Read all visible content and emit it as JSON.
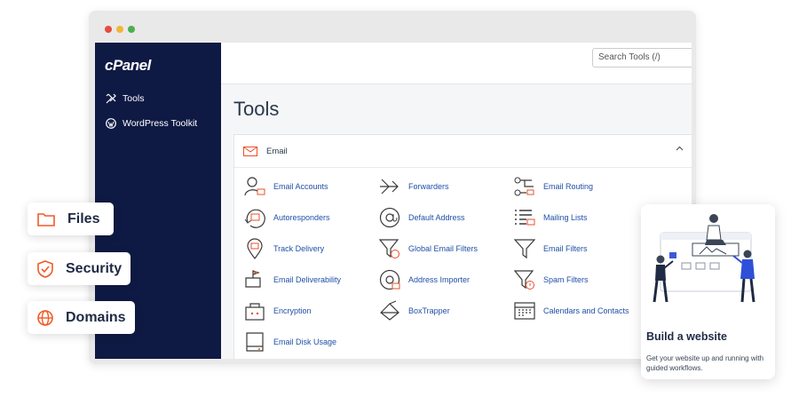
{
  "sidebar": {
    "logo": "cPanel",
    "items": [
      {
        "label": "Tools",
        "icon": "tools-icon"
      },
      {
        "label": "WordPress Toolkit",
        "icon": "wordpress-icon"
      }
    ]
  },
  "search": {
    "placeholder": "Search Tools (/)"
  },
  "main": {
    "title": "Tools"
  },
  "email_panel": {
    "title": "Email",
    "tools": [
      {
        "label": "Email Accounts",
        "icon": "email-accounts-icon"
      },
      {
        "label": "Forwarders",
        "icon": "forwarders-icon"
      },
      {
        "label": "Email Routing",
        "icon": "email-routing-icon"
      },
      {
        "label": "Autoresponders",
        "icon": "autoresponders-icon"
      },
      {
        "label": "Default Address",
        "icon": "default-address-icon"
      },
      {
        "label": "Mailing Lists",
        "icon": "mailing-lists-icon"
      },
      {
        "label": "Track Delivery",
        "icon": "track-delivery-icon"
      },
      {
        "label": "Global Email Filters",
        "icon": "global-email-filters-icon"
      },
      {
        "label": "Email Filters",
        "icon": "email-filters-icon"
      },
      {
        "label": "Email Deliverability",
        "icon": "email-deliverability-icon"
      },
      {
        "label": "Address Importer",
        "icon": "address-importer-icon"
      },
      {
        "label": "Spam Filters",
        "icon": "spam-filters-icon"
      },
      {
        "label": "Encryption",
        "icon": "encryption-icon"
      },
      {
        "label": "BoxTrapper",
        "icon": "boxtrapper-icon"
      },
      {
        "label": "Calendars and Contacts",
        "icon": "calendars-contacts-icon"
      },
      {
        "label": "Email Disk Usage",
        "icon": "email-disk-usage-icon"
      }
    ]
  },
  "feature_chips": [
    {
      "label": "Files",
      "icon": "folder-icon"
    },
    {
      "label": "Security",
      "icon": "shield-icon"
    },
    {
      "label": "Domains",
      "icon": "globe-icon"
    }
  ],
  "promo_card": {
    "title": "Build a website",
    "description": "Get your website up and running with guided workflows."
  },
  "colors": {
    "sidebar": "#0f1a44",
    "link": "#1f4fa8",
    "accent": "#f05a28"
  }
}
